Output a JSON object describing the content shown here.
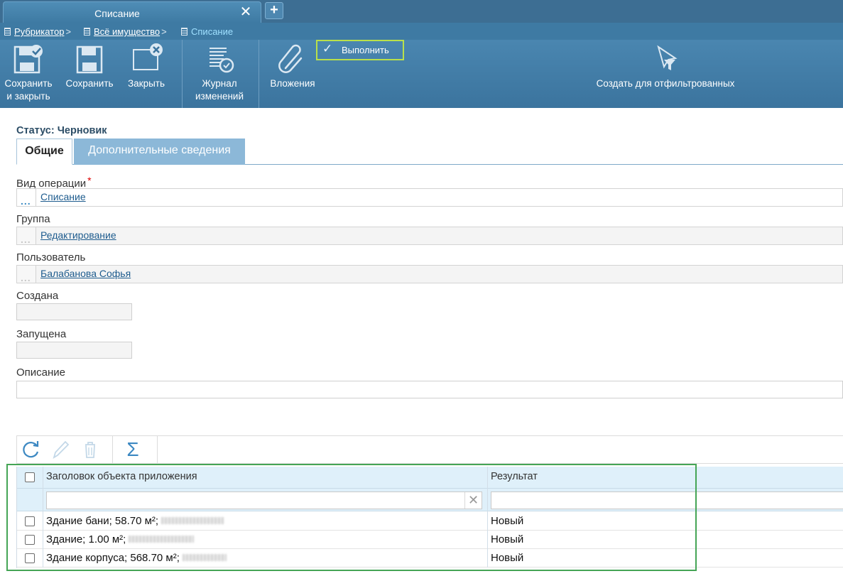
{
  "window": {
    "tab_title": "Списание",
    "close_symbol": "✕",
    "new_tab_symbol": "+"
  },
  "breadcrumb": {
    "items": [
      {
        "label": "Рубрикатор",
        "separator": ">"
      },
      {
        "label": "Всё имущество",
        "separator": ">"
      },
      {
        "label": "Списание"
      }
    ]
  },
  "toolbar": {
    "save_close": {
      "line1": "Сохранить",
      "line2": "и закрыть",
      "icon": "save-close-icon"
    },
    "save": {
      "label": "Сохранить",
      "icon": "save-icon"
    },
    "close": {
      "label": "Закрыть",
      "icon": "close-window-icon"
    },
    "journal": {
      "line1": "Журнал",
      "line2": "изменений",
      "icon": "journal-icon"
    },
    "attachments": {
      "label": "Вложения",
      "icon": "paperclip-icon"
    },
    "execute": {
      "label": "Выполнить",
      "icon": "checkmark-icon",
      "highlight_color": "#b9e04a"
    },
    "create_filtered": {
      "label": "Создать для отфильтрованных",
      "icon": "filter-cursor-icon"
    }
  },
  "form": {
    "status": "Статус: Черновик",
    "tabs": [
      {
        "label": "Общие",
        "active": true
      },
      {
        "label": "Дополнительные сведения",
        "active": false
      }
    ],
    "fields": {
      "operation_type": {
        "label": "Вид операции",
        "required_mark": "*",
        "value": "Списание",
        "button": "..."
      },
      "group": {
        "label": "Группа",
        "value": "Редактирование",
        "button": "..."
      },
      "user": {
        "label": "Пользователь",
        "value": "Балабанова Софья",
        "button": "..."
      },
      "created": {
        "label": "Создана",
        "value": ""
      },
      "started": {
        "label": "Запущена",
        "value": ""
      },
      "description": {
        "label": "Описание",
        "value": ""
      }
    }
  },
  "grid": {
    "toolbar_icons": [
      "refresh-icon",
      "edit-icon",
      "delete-icon",
      "sum-icon"
    ],
    "sum_symbol": "Σ",
    "columns": [
      "Заголовок объекта приложения",
      "Результат"
    ],
    "filters": [
      "",
      ""
    ],
    "clear_symbol": "✕",
    "rows": [
      {
        "title": "Здание бани; 58.70 м²;",
        "result": "Новый"
      },
      {
        "title": "Здание; 1.00 м²;",
        "result": "Новый"
      },
      {
        "title": "Здание корпуса; 568.70 м²;",
        "result": "Новый"
      }
    ],
    "highlight_color": "#45a556"
  }
}
